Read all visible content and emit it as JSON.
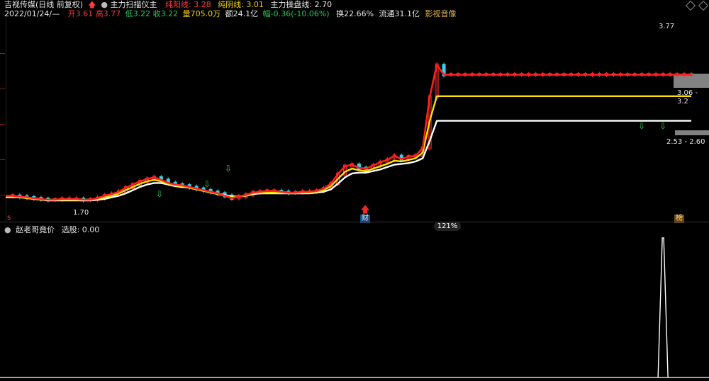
{
  "header": {
    "stock_name": "吉视传媒(日线 前复权)",
    "indicator_name": "主力扫描仪主",
    "line1_label": "纯阳线: 3.28",
    "line2_label": "纯阴线: 3.01",
    "line3_label": "主力操盘线: 2.70"
  },
  "quote": {
    "date": "2022/01/24/—",
    "open": "开3.61",
    "high": "高3.77",
    "low": "低3.22",
    "close": "收3.22",
    "volume": "量705.0万",
    "amount": "额24.1亿",
    "change": "幅-0.36(-10.06%)",
    "turnover": "换22.66%",
    "float": "流通31.1亿",
    "sector": "影视音像"
  },
  "annotations": {
    "high_price": "3.77",
    "mid_range": "3.06 - 3.2",
    "low_range": "2.53 - 2.60",
    "low_price": "1.70",
    "zoom": "121%",
    "tag_cai": "财",
    "tag_bang": "榜",
    "left_tag": "s"
  },
  "sub_panel": {
    "title": "赵老哥竟价",
    "value_label": "选股: 0.00"
  },
  "colors": {
    "up": "#ff2a2a",
    "down": "#39d0e8",
    "line_red": "#ff2020",
    "line_yellow": "#ffe000",
    "line_white": "#ffffff"
  },
  "chart_data": {
    "type": "line",
    "title": "吉视传媒(日线 前复权)",
    "ylim": [
      1.55,
      3.95
    ],
    "x": [
      0,
      10,
      20,
      30,
      40,
      50,
      60,
      70,
      80,
      90,
      100,
      110,
      120,
      130,
      140,
      150,
      160,
      170,
      180,
      190,
      200,
      210,
      220,
      230,
      240,
      250,
      260,
      270,
      280,
      290,
      300,
      310,
      320,
      330,
      340,
      350,
      360,
      370,
      380,
      390,
      400,
      410,
      420,
      430,
      440,
      450,
      460,
      470,
      480,
      490,
      500,
      510,
      520,
      530,
      540,
      550,
      560,
      570,
      580,
      590,
      600,
      610,
      620,
      630,
      640,
      650,
      660,
      670,
      680,
      690,
      700,
      710,
      720,
      730,
      740,
      750,
      760,
      770,
      780,
      790,
      800,
      810,
      820,
      830,
      840,
      850,
      860,
      870,
      880,
      890,
      900,
      910,
      920,
      930,
      940,
      950,
      960,
      970
    ],
    "series": [
      {
        "name": "纯阳线",
        "color": "#ff2020",
        "values": [
          1.76,
          1.76,
          1.75,
          1.74,
          1.73,
          1.72,
          1.71,
          1.71,
          1.72,
          1.72,
          1.72,
          1.71,
          1.71,
          1.73,
          1.76,
          1.78,
          1.81,
          1.86,
          1.9,
          1.94,
          1.97,
          1.99,
          1.96,
          1.92,
          1.9,
          1.89,
          1.87,
          1.85,
          1.83,
          1.81,
          1.79,
          1.76,
          1.73,
          1.75,
          1.77,
          1.8,
          1.81,
          1.82,
          1.82,
          1.81,
          1.8,
          1.8,
          1.81,
          1.81,
          1.82,
          1.85,
          1.91,
          2.03,
          2.13,
          2.15,
          2.11,
          2.1,
          2.14,
          2.18,
          2.21,
          2.26,
          2.22,
          2.25,
          2.26,
          2.36,
          3.0,
          3.4,
          3.28,
          3.28,
          3.28,
          3.28,
          3.28,
          3.28,
          3.28,
          3.28,
          3.28,
          3.28,
          3.28,
          3.28,
          3.28,
          3.28,
          3.28,
          3.28,
          3.28,
          3.28,
          3.28,
          3.28,
          3.28,
          3.28,
          3.28,
          3.28,
          3.28,
          3.28,
          3.28,
          3.28,
          3.28,
          3.28,
          3.28,
          3.28,
          3.28,
          3.28,
          3.28,
          3.28
        ]
      },
      {
        "name": "纯阴线",
        "color": "#ffe000",
        "values": [
          1.75,
          1.75,
          1.74,
          1.73,
          1.72,
          1.71,
          1.71,
          1.71,
          1.71,
          1.71,
          1.71,
          1.71,
          1.71,
          1.72,
          1.74,
          1.76,
          1.79,
          1.83,
          1.87,
          1.91,
          1.94,
          1.96,
          1.94,
          1.91,
          1.89,
          1.88,
          1.86,
          1.84,
          1.82,
          1.8,
          1.78,
          1.76,
          1.74,
          1.75,
          1.76,
          1.79,
          1.8,
          1.8,
          1.8,
          1.8,
          1.79,
          1.79,
          1.8,
          1.8,
          1.81,
          1.83,
          1.88,
          1.97,
          2.06,
          2.1,
          2.08,
          2.07,
          2.1,
          2.13,
          2.16,
          2.2,
          2.19,
          2.21,
          2.23,
          2.3,
          2.7,
          3.01,
          3.01,
          3.01,
          3.01,
          3.01,
          3.01,
          3.01,
          3.01,
          3.01,
          3.01,
          3.01,
          3.01,
          3.01,
          3.01,
          3.01,
          3.01,
          3.01,
          3.01,
          3.01,
          3.01,
          3.01,
          3.01,
          3.01,
          3.01,
          3.01,
          3.01,
          3.01,
          3.01,
          3.01,
          3.01,
          3.01,
          3.01,
          3.01,
          3.01,
          3.01,
          3.01,
          3.01
        ]
      },
      {
        "name": "主力操盘线",
        "color": "#ffffff",
        "values": [
          1.74,
          1.74,
          1.74,
          1.73,
          1.72,
          1.71,
          1.7,
          1.7,
          1.7,
          1.7,
          1.7,
          1.7,
          1.7,
          1.71,
          1.72,
          1.74,
          1.76,
          1.79,
          1.83,
          1.87,
          1.9,
          1.92,
          1.92,
          1.9,
          1.88,
          1.87,
          1.86,
          1.84,
          1.83,
          1.81,
          1.79,
          1.77,
          1.75,
          1.75,
          1.76,
          1.78,
          1.79,
          1.79,
          1.79,
          1.79,
          1.79,
          1.79,
          1.79,
          1.79,
          1.8,
          1.81,
          1.84,
          1.91,
          1.99,
          2.04,
          2.05,
          2.05,
          2.07,
          2.09,
          2.12,
          2.15,
          2.16,
          2.17,
          2.19,
          2.23,
          2.45,
          2.7,
          2.7,
          2.7,
          2.7,
          2.7,
          2.7,
          2.7,
          2.7,
          2.7,
          2.7,
          2.7,
          2.7,
          2.7,
          2.7,
          2.7,
          2.7,
          2.7,
          2.7,
          2.7,
          2.7,
          2.7,
          2.7,
          2.7,
          2.7,
          2.7,
          2.7,
          2.7,
          2.7,
          2.7,
          2.7,
          2.7,
          2.7,
          2.7,
          2.7,
          2.7,
          2.7,
          2.7
        ]
      }
    ],
    "sub_series": {
      "name": "选股",
      "peak_index": 93,
      "peak_value": 1.0
    }
  }
}
